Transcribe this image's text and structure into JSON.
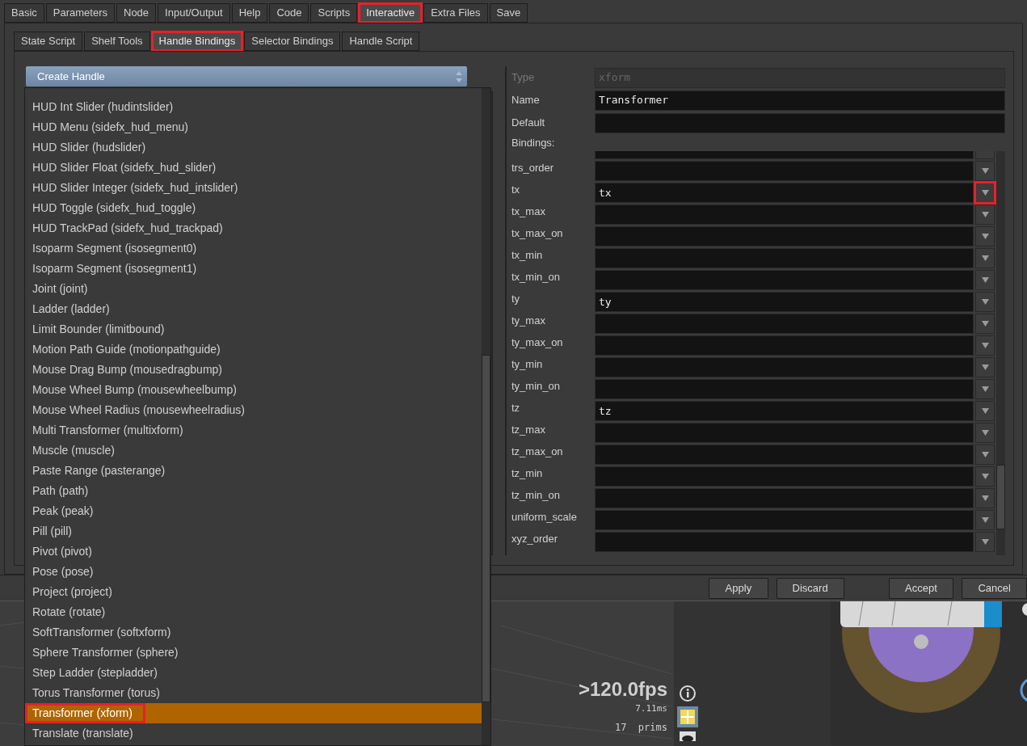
{
  "tabs": [
    {
      "label": "Basic",
      "selected": false,
      "highlighted": false
    },
    {
      "label": "Parameters",
      "selected": false,
      "highlighted": false
    },
    {
      "label": "Node",
      "selected": false,
      "highlighted": false
    },
    {
      "label": "Input/Output",
      "selected": false,
      "highlighted": false
    },
    {
      "label": "Help",
      "selected": false,
      "highlighted": false
    },
    {
      "label": "Code",
      "selected": false,
      "highlighted": false
    },
    {
      "label": "Scripts",
      "selected": false,
      "highlighted": false
    },
    {
      "label": "Interactive",
      "selected": true,
      "highlighted": true
    },
    {
      "label": "Extra Files",
      "selected": false,
      "highlighted": false
    },
    {
      "label": "Save",
      "selected": false,
      "highlighted": false
    }
  ],
  "subtabs": [
    {
      "label": "State Script",
      "selected": false,
      "highlighted": false
    },
    {
      "label": "Shelf Tools",
      "selected": false,
      "highlighted": false
    },
    {
      "label": "Handle Bindings",
      "selected": true,
      "highlighted": true
    },
    {
      "label": "Selector Bindings",
      "selected": false,
      "highlighted": false
    },
    {
      "label": "Handle Script",
      "selected": false,
      "highlighted": false
    }
  ],
  "create_handle": {
    "label": "Create Handle",
    "items": [
      {
        "label": "HUD Int Slider (hudintslider)",
        "selected": false,
        "highlighted": false
      },
      {
        "label": "HUD Menu (sidefx_hud_menu)",
        "selected": false,
        "highlighted": false
      },
      {
        "label": "HUD Slider (hudslider)",
        "selected": false,
        "highlighted": false
      },
      {
        "label": "HUD Slider Float (sidefx_hud_slider)",
        "selected": false,
        "highlighted": false
      },
      {
        "label": "HUD Slider Integer (sidefx_hud_intslider)",
        "selected": false,
        "highlighted": false
      },
      {
        "label": "HUD Toggle (sidefx_hud_toggle)",
        "selected": false,
        "highlighted": false
      },
      {
        "label": "HUD TrackPad (sidefx_hud_trackpad)",
        "selected": false,
        "highlighted": false
      },
      {
        "label": "Isoparm Segment (isosegment0)",
        "selected": false,
        "highlighted": false
      },
      {
        "label": "Isoparm Segment (isosegment1)",
        "selected": false,
        "highlighted": false
      },
      {
        "label": "Joint (joint)",
        "selected": false,
        "highlighted": false
      },
      {
        "label": "Ladder (ladder)",
        "selected": false,
        "highlighted": false
      },
      {
        "label": "Limit Bounder (limitbound)",
        "selected": false,
        "highlighted": false
      },
      {
        "label": "Motion Path Guide (motionpathguide)",
        "selected": false,
        "highlighted": false
      },
      {
        "label": "Mouse Drag Bump (mousedragbump)",
        "selected": false,
        "highlighted": false
      },
      {
        "label": "Mouse Wheel Bump (mousewheelbump)",
        "selected": false,
        "highlighted": false
      },
      {
        "label": "Mouse Wheel Radius (mousewheelradius)",
        "selected": false,
        "highlighted": false
      },
      {
        "label": "Multi Transformer (multixform)",
        "selected": false,
        "highlighted": false
      },
      {
        "label": "Muscle (muscle)",
        "selected": false,
        "highlighted": false
      },
      {
        "label": "Paste Range (pasterange)",
        "selected": false,
        "highlighted": false
      },
      {
        "label": "Path (path)",
        "selected": false,
        "highlighted": false
      },
      {
        "label": "Peak (peak)",
        "selected": false,
        "highlighted": false
      },
      {
        "label": "Pill (pill)",
        "selected": false,
        "highlighted": false
      },
      {
        "label": "Pivot (pivot)",
        "selected": false,
        "highlighted": false
      },
      {
        "label": "Pose (pose)",
        "selected": false,
        "highlighted": false
      },
      {
        "label": "Project (project)",
        "selected": false,
        "highlighted": false
      },
      {
        "label": "Rotate (rotate)",
        "selected": false,
        "highlighted": false
      },
      {
        "label": "SoftTransformer (softxform)",
        "selected": false,
        "highlighted": false
      },
      {
        "label": "Sphere Transformer (sphere)",
        "selected": false,
        "highlighted": false
      },
      {
        "label": "Step Ladder (stepladder)",
        "selected": false,
        "highlighted": false
      },
      {
        "label": "Torus Transformer (torus)",
        "selected": false,
        "highlighted": false
      },
      {
        "label": "Transformer (xform)",
        "selected": true,
        "highlighted": true
      },
      {
        "label": "Translate (translate)",
        "selected": false,
        "highlighted": false
      }
    ]
  },
  "fields": [
    {
      "label": "Type",
      "value": "xform",
      "disabled": true
    },
    {
      "label": "Name",
      "value": "Transformer",
      "disabled": false
    },
    {
      "label": "Default",
      "disabled": false
    }
  ],
  "bindings_label": "Bindings:",
  "bindings": [
    {
      "label": "trs_order",
      "highlighted": false
    },
    {
      "label": "tx",
      "value": "tx",
      "highlighted": true
    },
    {
      "label": "tx_max",
      "highlighted": false
    },
    {
      "label": "tx_max_on",
      "highlighted": false
    },
    {
      "label": "tx_min",
      "highlighted": false
    },
    {
      "label": "tx_min_on",
      "highlighted": false
    },
    {
      "label": "ty",
      "value": "ty",
      "highlighted": false
    },
    {
      "label": "ty_max",
      "highlighted": false
    },
    {
      "label": "ty_max_on",
      "highlighted": false
    },
    {
      "label": "ty_min",
      "highlighted": false
    },
    {
      "label": "ty_min_on",
      "highlighted": false
    },
    {
      "label": "tz",
      "value": "tz",
      "highlighted": false
    },
    {
      "label": "tz_max",
      "highlighted": false
    },
    {
      "label": "tz_max_on",
      "highlighted": false
    },
    {
      "label": "tz_min",
      "highlighted": false
    },
    {
      "label": "tz_min_on",
      "highlighted": false
    },
    {
      "label": "uniform_scale",
      "highlighted": false
    },
    {
      "label": "xyz_order",
      "highlighted": false
    }
  ],
  "buttons": [
    "Apply",
    "Discard",
    "Accept",
    "Cancel"
  ],
  "viewport": {
    "fps": ">120.0fps",
    "time": "7.11ms",
    "prims": "17  prims"
  }
}
